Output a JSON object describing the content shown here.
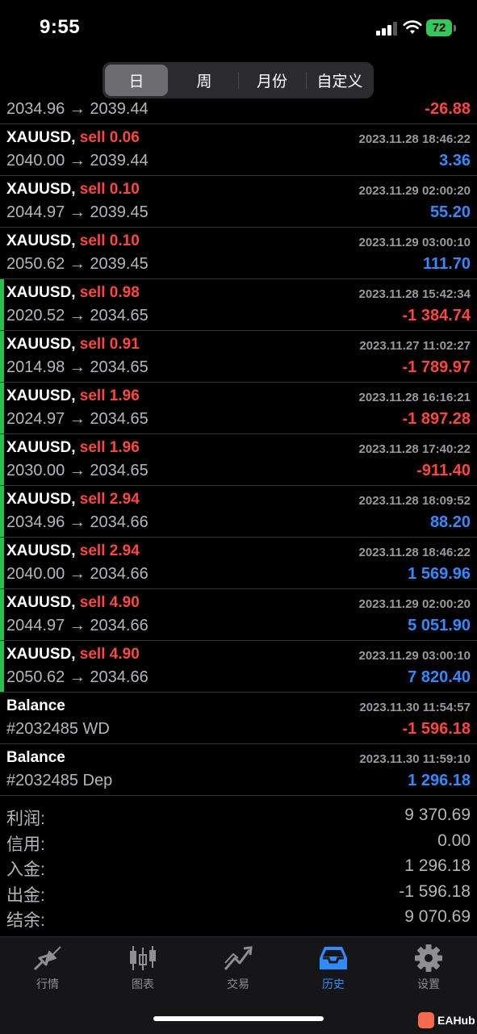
{
  "status": {
    "time": "9:55",
    "battery": "72"
  },
  "tabs_top": [
    "日",
    "周",
    "月份",
    "自定义"
  ],
  "rows": [
    {
      "symbol": "",
      "side": "",
      "volume": "",
      "date": "",
      "price": "2034.96 → 2039.44",
      "profit": "-26.88",
      "neg": true,
      "bar": false
    },
    {
      "symbol": "XAUUSD,",
      "side": "sell",
      "volume": "0.06",
      "date": "2023.11.28 18:46:22",
      "price": "2040.00 → 2039.44",
      "profit": "3.36",
      "neg": false,
      "bar": false
    },
    {
      "symbol": "XAUUSD,",
      "side": "sell",
      "volume": "0.10",
      "date": "2023.11.29 02:00:20",
      "price": "2044.97 → 2039.45",
      "profit": "55.20",
      "neg": false,
      "bar": false
    },
    {
      "symbol": "XAUUSD,",
      "side": "sell",
      "volume": "0.10",
      "date": "2023.11.29 03:00:10",
      "price": "2050.62 → 2039.45",
      "profit": "111.70",
      "neg": false,
      "bar": false
    },
    {
      "symbol": "XAUUSD,",
      "side": "sell",
      "volume": "0.98",
      "date": "2023.11.28 15:42:34",
      "price": "2020.52 → 2034.65",
      "profit": "-1 384.74",
      "neg": true,
      "bar": true
    },
    {
      "symbol": "XAUUSD,",
      "side": "sell",
      "volume": "0.91",
      "date": "2023.11.27 11:02:27",
      "price": "2014.98 → 2034.65",
      "profit": "-1 789.97",
      "neg": true,
      "bar": true
    },
    {
      "symbol": "XAUUSD,",
      "side": "sell",
      "volume": "1.96",
      "date": "2023.11.28 16:16:21",
      "price": "2024.97 → 2034.65",
      "profit": "-1 897.28",
      "neg": true,
      "bar": true
    },
    {
      "symbol": "XAUUSD,",
      "side": "sell",
      "volume": "1.96",
      "date": "2023.11.28 17:40:22",
      "price": "2030.00 → 2034.65",
      "profit": "-911.40",
      "neg": true,
      "bar": true
    },
    {
      "symbol": "XAUUSD,",
      "side": "sell",
      "volume": "2.94",
      "date": "2023.11.28 18:09:52",
      "price": "2034.96 → 2034.66",
      "profit": "88.20",
      "neg": false,
      "bar": true
    },
    {
      "symbol": "XAUUSD,",
      "side": "sell",
      "volume": "2.94",
      "date": "2023.11.28 18:46:22",
      "price": "2040.00 → 2034.66",
      "profit": "1 569.96",
      "neg": false,
      "bar": true
    },
    {
      "symbol": "XAUUSD,",
      "side": "sell",
      "volume": "4.90",
      "date": "2023.11.29 02:00:20",
      "price": "2044.97 → 2034.66",
      "profit": "5 051.90",
      "neg": false,
      "bar": true
    },
    {
      "symbol": "XAUUSD,",
      "side": "sell",
      "volume": "4.90",
      "date": "2023.11.29 03:00:10",
      "price": "2050.62 → 2034.66",
      "profit": "7 820.40",
      "neg": false,
      "bar": true
    },
    {
      "symbol": "Balance",
      "side": "",
      "volume": "",
      "date": "2023.11.30 11:54:57",
      "price": "#2032485 WD",
      "profit": "-1 596.18",
      "neg": true,
      "bar": false
    },
    {
      "symbol": "Balance",
      "side": "",
      "volume": "",
      "date": "2023.11.30 11:59:10",
      "price": "#2032485 Dep",
      "profit": "1 296.18",
      "neg": false,
      "bar": false
    }
  ],
  "summary": [
    {
      "label": "利润:",
      "value": "9 370.69"
    },
    {
      "label": "信用:",
      "value": "0.00"
    },
    {
      "label": "入金:",
      "value": "1 296.18"
    },
    {
      "label": "出金:",
      "value": "-1 596.18"
    },
    {
      "label": "结余:",
      "value": "9 070.69"
    }
  ],
  "tabbar": [
    "行情",
    "图表",
    "交易",
    "历史",
    "设置"
  ],
  "watermark": "EAHub",
  "colors": {
    "red": "#ff453a",
    "blue": "#2f8cff",
    "green_bar": "#27c24c",
    "active_tab": "#2f8cff"
  }
}
